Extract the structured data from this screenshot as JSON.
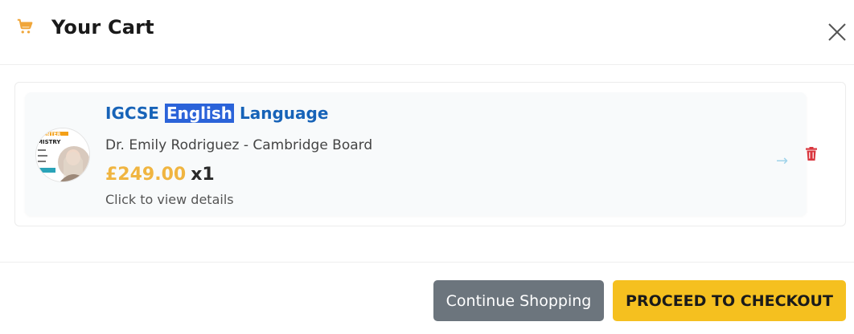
{
  "header": {
    "title": "Your Cart",
    "icon": "shopping-cart-icon"
  },
  "cart": {
    "items": [
      {
        "title_parts": [
          "IGCSE ",
          "English",
          " Language"
        ],
        "subtitle": "Dr. Emily Rodriguez - Cambridge Board",
        "price": "£249.00",
        "quantity": "x1",
        "link_text": "Click to view details",
        "thumbnail": {
          "banner_top": "CENTER",
          "banner_word": "MISTRY"
        }
      }
    ]
  },
  "footer": {
    "continue_label": "Continue Shopping",
    "checkout_label": "PROCEED TO CHECKOUT"
  },
  "colors": {
    "title_blue": "#1763b8",
    "price_gold": "#f0b541",
    "checkout_yellow": "#f5c01f",
    "continue_gray": "#6c757d",
    "trash_red": "#d9363e",
    "cart_icon_orange": "#f0a63a"
  }
}
